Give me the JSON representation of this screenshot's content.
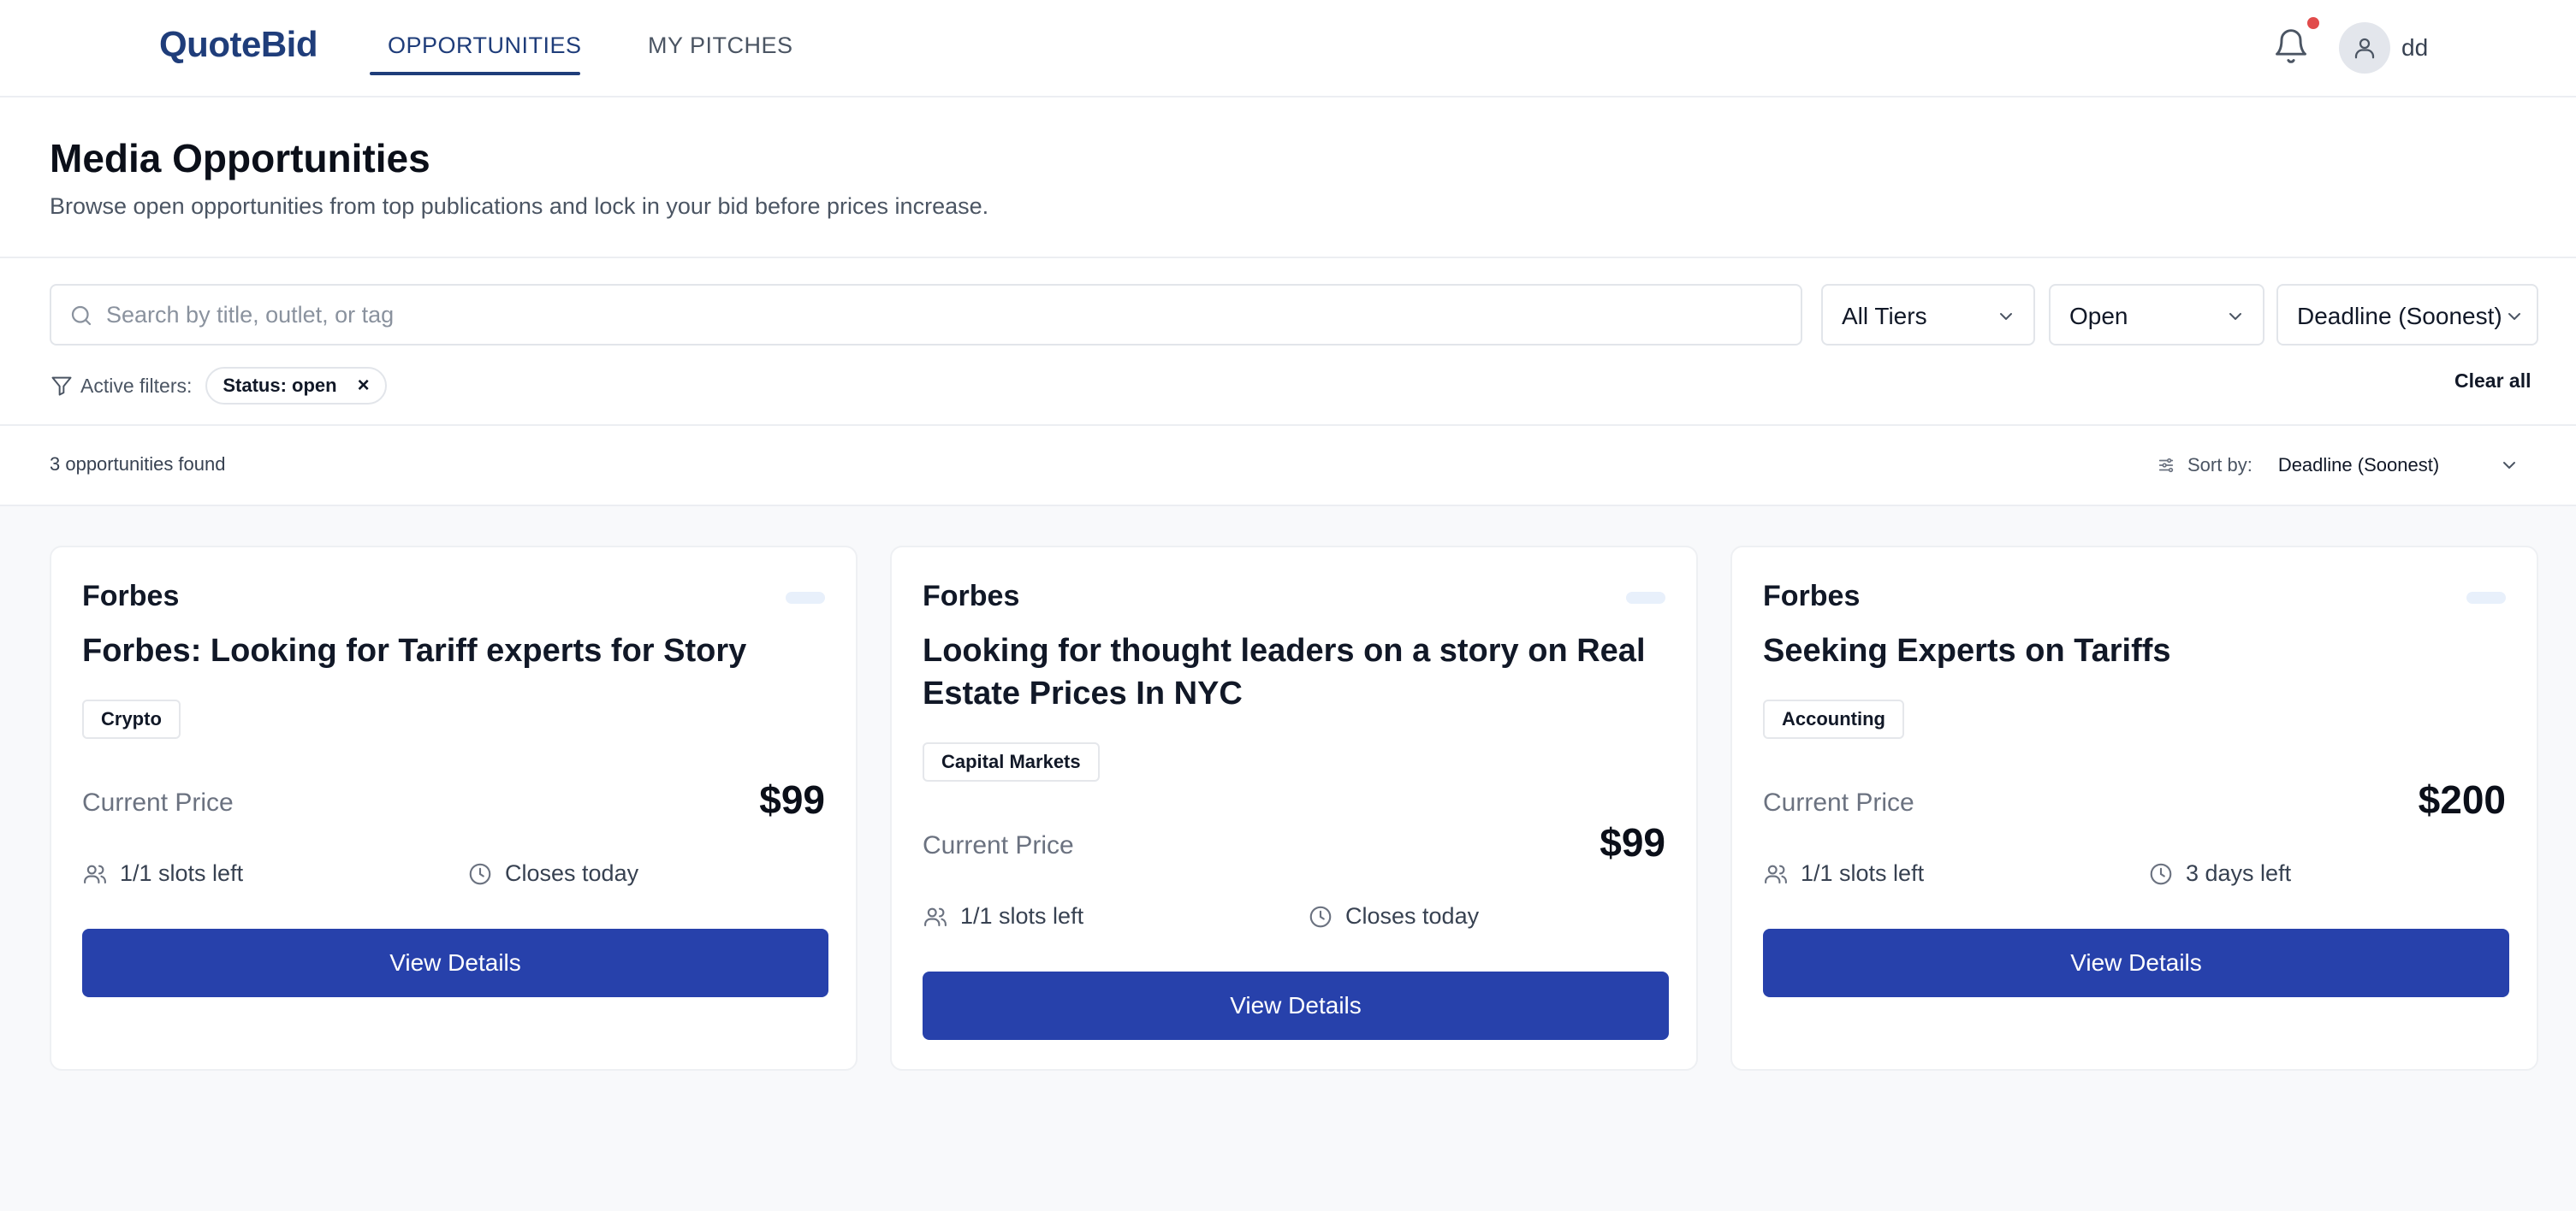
{
  "app": {
    "logo": "QuoteBid",
    "nav": [
      {
        "label": "OPPORTUNITIES",
        "active": true
      },
      {
        "label": "MY PITCHES",
        "active": false
      }
    ],
    "user": {
      "name": "dd"
    },
    "notification_dot_color": "#e14b4b"
  },
  "header": {
    "title": "Media Opportunities",
    "subtitle": "Browse open opportunities from top publications and lock in your bid before prices increase."
  },
  "filters": {
    "search_placeholder": "Search by title, outlet, or tag",
    "tier_select": "All Tiers",
    "status_select": "Open",
    "sort_select": "Deadline (Soonest)",
    "active_filters_label": "Active filters:",
    "active_chips": [
      {
        "label": "Status: open"
      }
    ],
    "clear_all": "Clear all"
  },
  "results": {
    "count_text": "3 opportunities found",
    "sort_label": "Sort by:",
    "sort_value": "Deadline (Soonest)"
  },
  "cards": [
    {
      "outlet": "Forbes",
      "title": "Forbes: Looking for Tariff experts for Story",
      "tag": "Crypto",
      "price_label": "Current Price",
      "price": "$99",
      "slots": "1/1 slots left",
      "deadline": "Closes today",
      "button": "View Details"
    },
    {
      "outlet": "Forbes",
      "title": "Looking for thought leaders on a story on Real Estate Prices In NYC",
      "tag": "Capital Markets",
      "price_label": "Current Price",
      "price": "$99",
      "slots": "1/1 slots left",
      "deadline": "Closes today",
      "button": "View Details"
    },
    {
      "outlet": "Forbes",
      "title": "Seeking Experts on Tariffs",
      "tag": "Accounting",
      "price_label": "Current Price",
      "price": "$200",
      "slots": "1/1 slots left",
      "deadline": "3 days left",
      "button": "View Details"
    }
  ],
  "colors": {
    "brand": "#1f3d7a",
    "primary_button": "#2741ab",
    "page_bg": "#f8f9fb"
  }
}
